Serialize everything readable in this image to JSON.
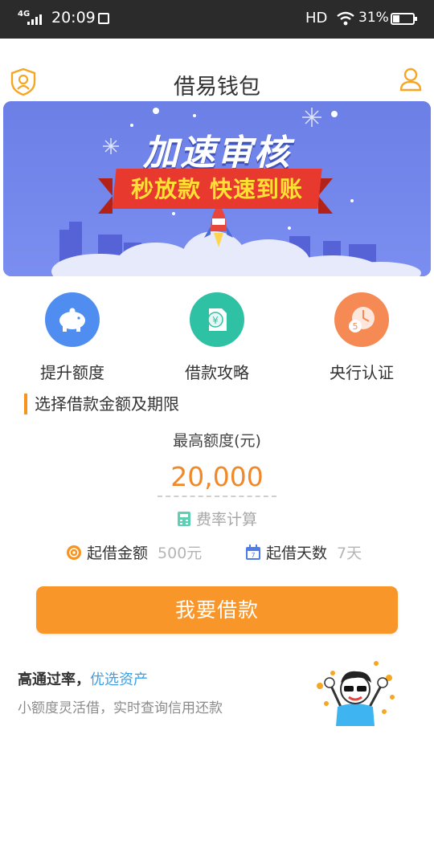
{
  "status_bar": {
    "network": "4G",
    "time": "20:09",
    "hd": "HD",
    "battery": "31%",
    "battery_level": 0.31
  },
  "header": {
    "title": "借易钱包"
  },
  "banner": {
    "headline": "加速审核",
    "subline": "秒放款 快速到账"
  },
  "features": [
    {
      "label": "提升额度",
      "icon": "piggy-bank-icon",
      "color": "#4f8ef0"
    },
    {
      "label": "借款攻略",
      "icon": "money-document-icon",
      "color": "#2fc1a4"
    },
    {
      "label": "央行认证",
      "icon": "clock-coin-icon",
      "color": "#f58a55"
    }
  ],
  "loan": {
    "section_title": "选择借款金额及期限",
    "max_label": "最高额度(元)",
    "amount": "20,000",
    "rate_calc": "费率计算",
    "min_amount_label": "起借金额",
    "min_amount_value": "500元",
    "min_days_label": "起借天数",
    "min_days_value": "7天",
    "calendar_day": "7",
    "button": "我要借款"
  },
  "promo": {
    "main_prefix": "高通过率，",
    "main_highlight": "优选资产",
    "sub": "小额度灵活借，实时查询信用还款"
  },
  "colors": {
    "accent": "#f9962a",
    "amount": "#f0892a",
    "link": "#3aa0e8",
    "banner_bg": "#6f83e8"
  }
}
